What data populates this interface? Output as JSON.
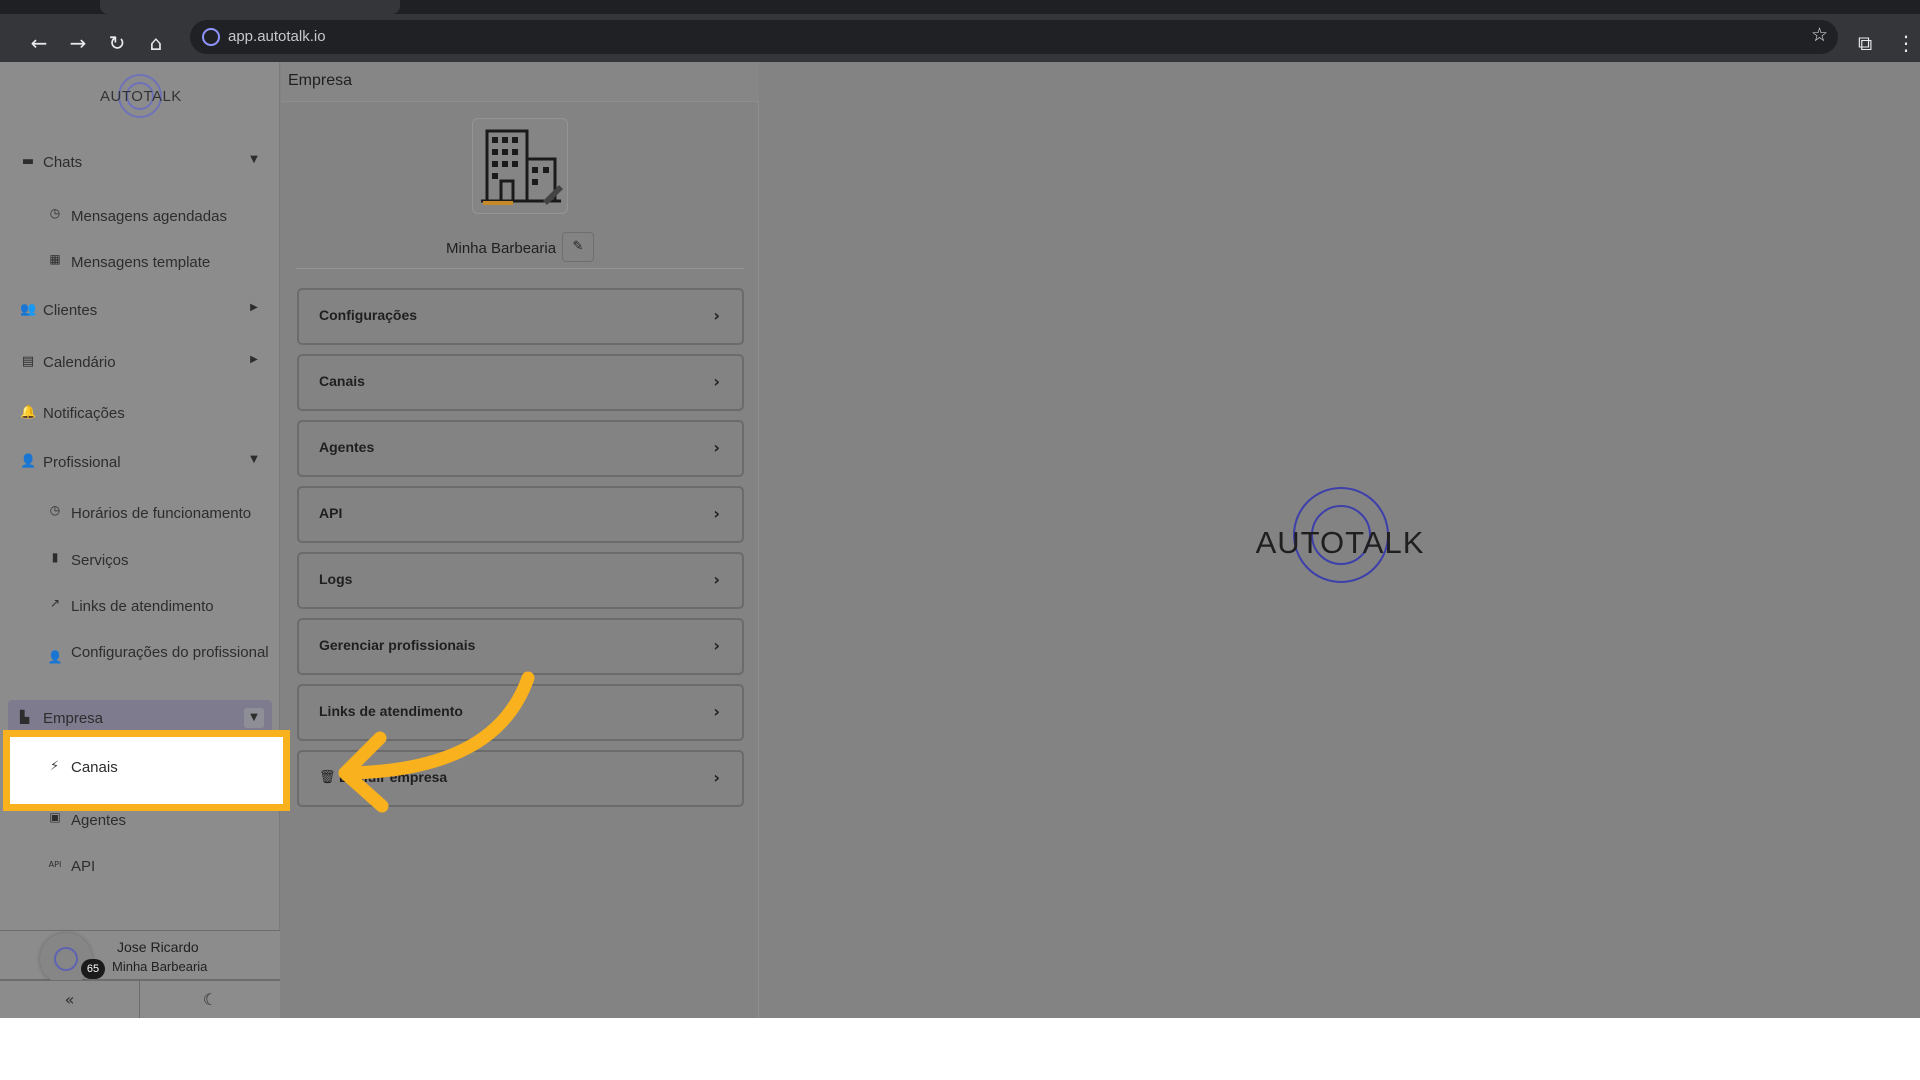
{
  "browser": {
    "url": "app.autotalk.io",
    "icons": {
      "back": "arrow-left-icon",
      "forward": "arrow-right-icon",
      "reload": "reload-icon",
      "home": "home-icon",
      "star": "star-icon",
      "extensions": "puzzle-icon",
      "menu": "kebab-menu-icon"
    }
  },
  "brand": {
    "logo_text": "AUTOTALK",
    "accent": "#5d62b3"
  },
  "sidebar": {
    "items": [
      {
        "label": "Chats",
        "icon": "chat-icon",
        "arrow": "down"
      },
      {
        "label": "Mensagens agendadas",
        "icon": "clock-icon"
      },
      {
        "label": "Mensagens template",
        "icon": "template-icon"
      },
      {
        "label": "Clientes",
        "icon": "users-icon",
        "arrow": "right"
      },
      {
        "label": "Calendário",
        "icon": "calendar-icon",
        "arrow": "right"
      },
      {
        "label": "Notificações",
        "icon": "bell-icon"
      },
      {
        "label": "Profissional",
        "icon": "user-cog-icon",
        "arrow": "down"
      },
      {
        "label": "Horários de funcionamento",
        "icon": "clock-icon"
      },
      {
        "label": "Serviços",
        "icon": "clipboard-icon"
      },
      {
        "label": "Links de atendimento",
        "icon": "external-link-icon"
      },
      {
        "label": "Configurações do profissional",
        "icon": "user-cog-icon"
      },
      {
        "label": "Empresa",
        "icon": "building-icon",
        "arrow": "down"
      },
      {
        "label": "Canais",
        "icon": "plug-icon"
      },
      {
        "label": "Agentes",
        "icon": "robot-icon"
      },
      {
        "label": "API",
        "icon": "api-icon"
      }
    ]
  },
  "user": {
    "name": "Jose Ricardo",
    "company": "Minha Barbearia",
    "badge": "65"
  },
  "footer": {
    "collapse_icon": "double-chevron-left-icon",
    "theme_icon": "moon-icon"
  },
  "panel": {
    "title": "Empresa",
    "company_name": "Minha Barbearia",
    "edit_icon": "edit-icon",
    "menu": [
      {
        "label": "Configurações"
      },
      {
        "label": "Canais"
      },
      {
        "label": "Agentes"
      },
      {
        "label": "API"
      },
      {
        "label": "Logs"
      },
      {
        "label": "Gerenciar profissionais"
      },
      {
        "label": "Links de atendimento"
      },
      {
        "label": "Excluir empresa",
        "icon": "trash-icon"
      }
    ]
  },
  "overlay": {
    "highlight_color": "#f9b21d"
  }
}
